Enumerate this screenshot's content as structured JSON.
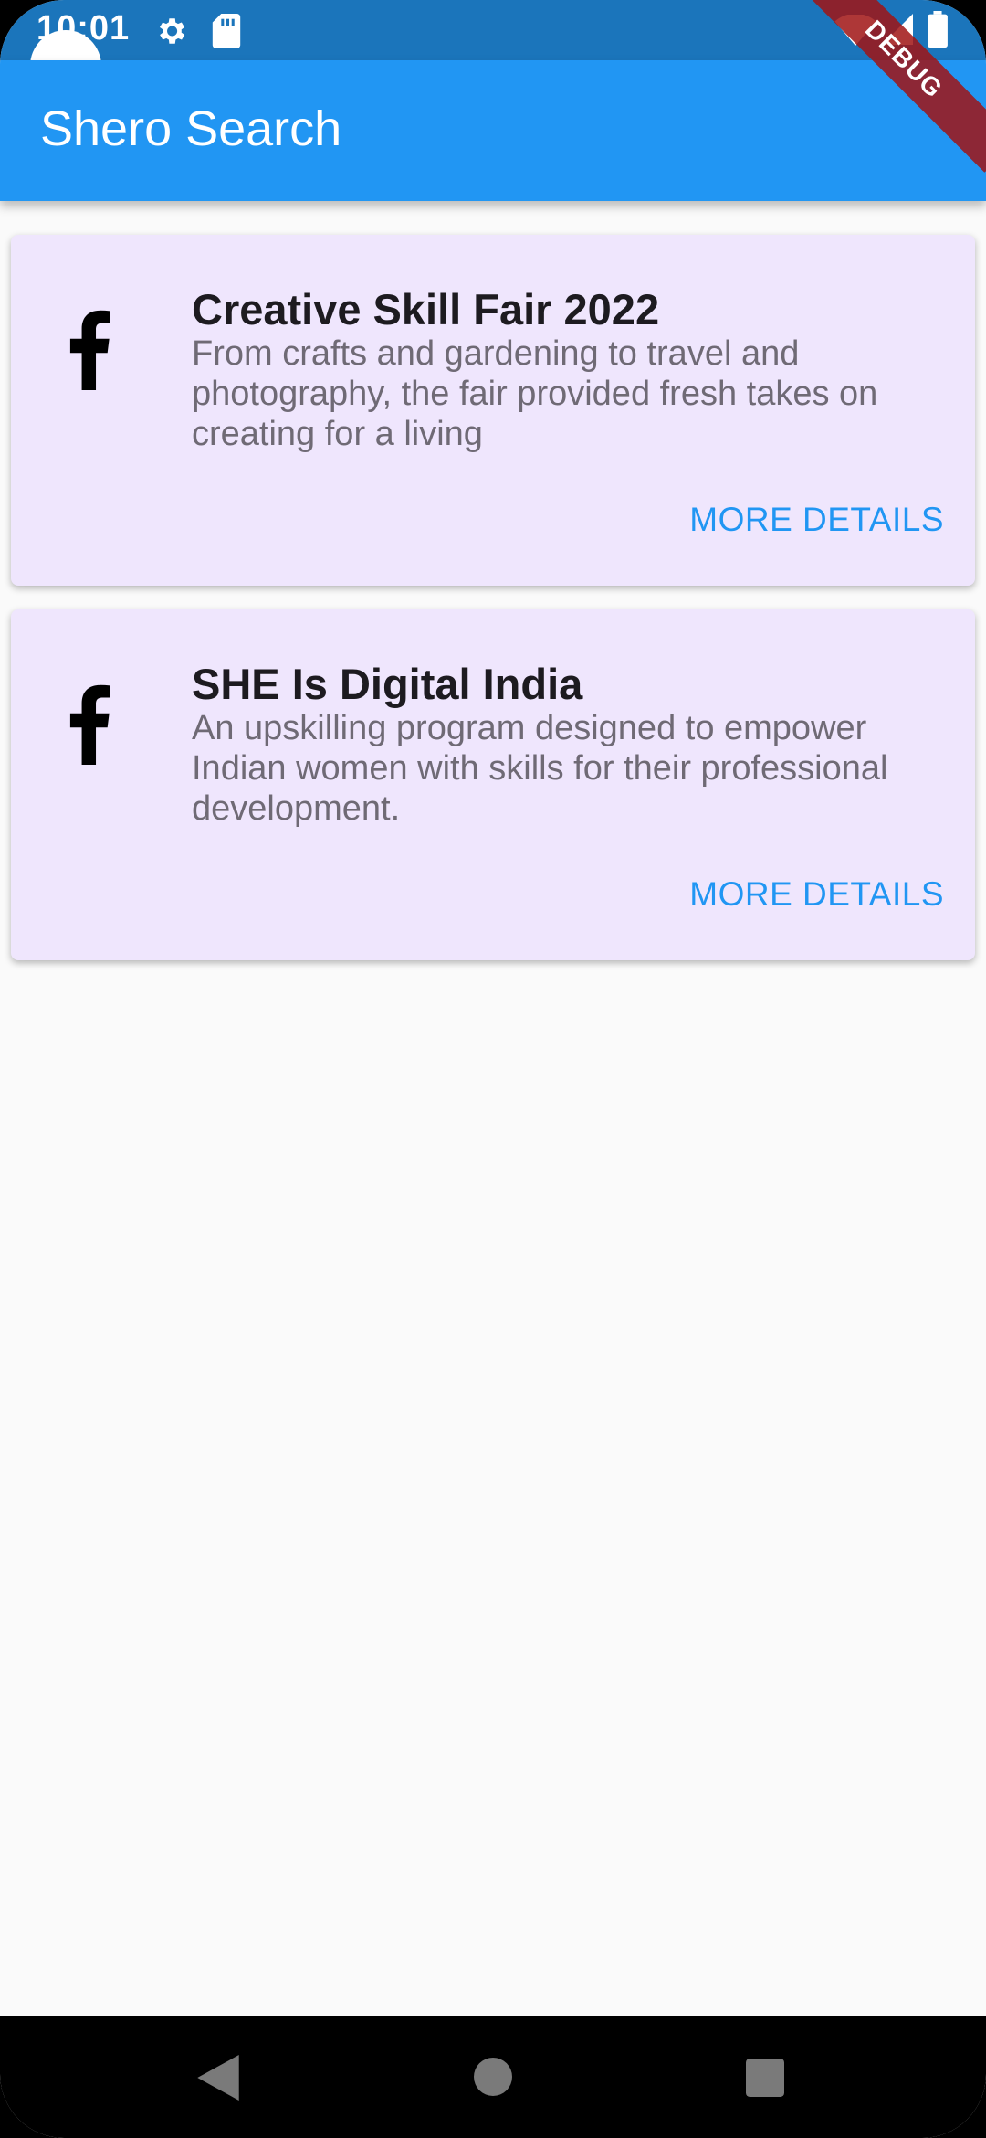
{
  "status_bar": {
    "time": "10:01",
    "icons": [
      "gear-icon",
      "sd-card-icon",
      "wifi-icon",
      "signal-icon",
      "battery-icon"
    ]
  },
  "debug_banner": "DEBUG",
  "app_bar": {
    "title": "Shero Search",
    "color": "#2196f3"
  },
  "cards": [
    {
      "icon": "facebook-icon",
      "title": "Creative Skill Fair 2022",
      "description": "From crafts and gardening to travel and photography, the fair provided fresh takes on creating for a living",
      "action": "MORE DETAILS"
    },
    {
      "icon": "facebook-icon",
      "title": "SHE Is Digital India",
      "description": "An upskilling program designed to empower Indian women with skills for their professional development.",
      "action": "MORE DETAILS"
    }
  ],
  "nav_bar": {
    "buttons": [
      "back-icon",
      "home-icon",
      "recents-icon"
    ]
  },
  "colors": {
    "card_background": "#efe6fd",
    "accent": "#2196f3",
    "status_bar": "#1b75bb"
  }
}
